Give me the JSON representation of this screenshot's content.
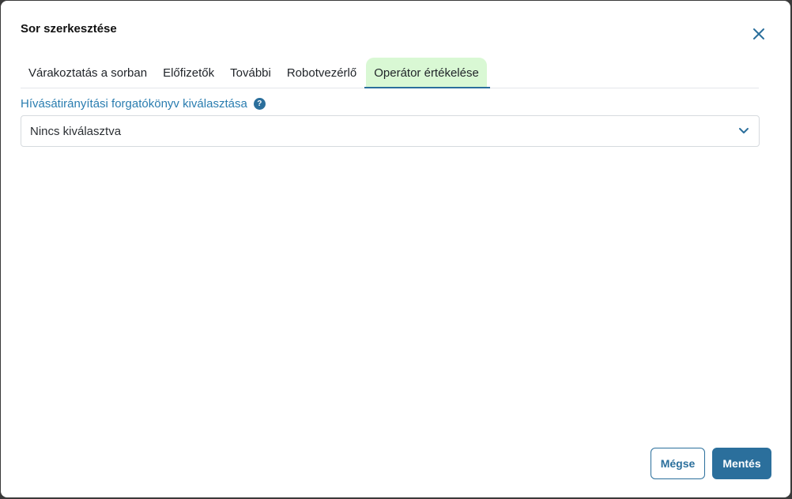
{
  "dialog": {
    "title": "Sor szerkesztése",
    "close_icon": "close-icon"
  },
  "tabs": [
    {
      "label": "Várakoztatás a sorban",
      "active": false
    },
    {
      "label": "Előfizetők",
      "active": false
    },
    {
      "label": "További",
      "active": false
    },
    {
      "label": "Robotvezérlő",
      "active": false
    },
    {
      "label": "Operátor értékelése",
      "active": true
    }
  ],
  "form": {
    "label": "Hívásátirányítási forgatókönyv kiválasztása",
    "help_icon": "?",
    "select_value": "Nincs kiválasztva"
  },
  "footer": {
    "cancel_label": "Mégse",
    "save_label": "Mentés"
  },
  "colors": {
    "accent": "#2b6f9c",
    "label": "#2a7db0",
    "active_tab_bg": "#d9f8d4"
  }
}
